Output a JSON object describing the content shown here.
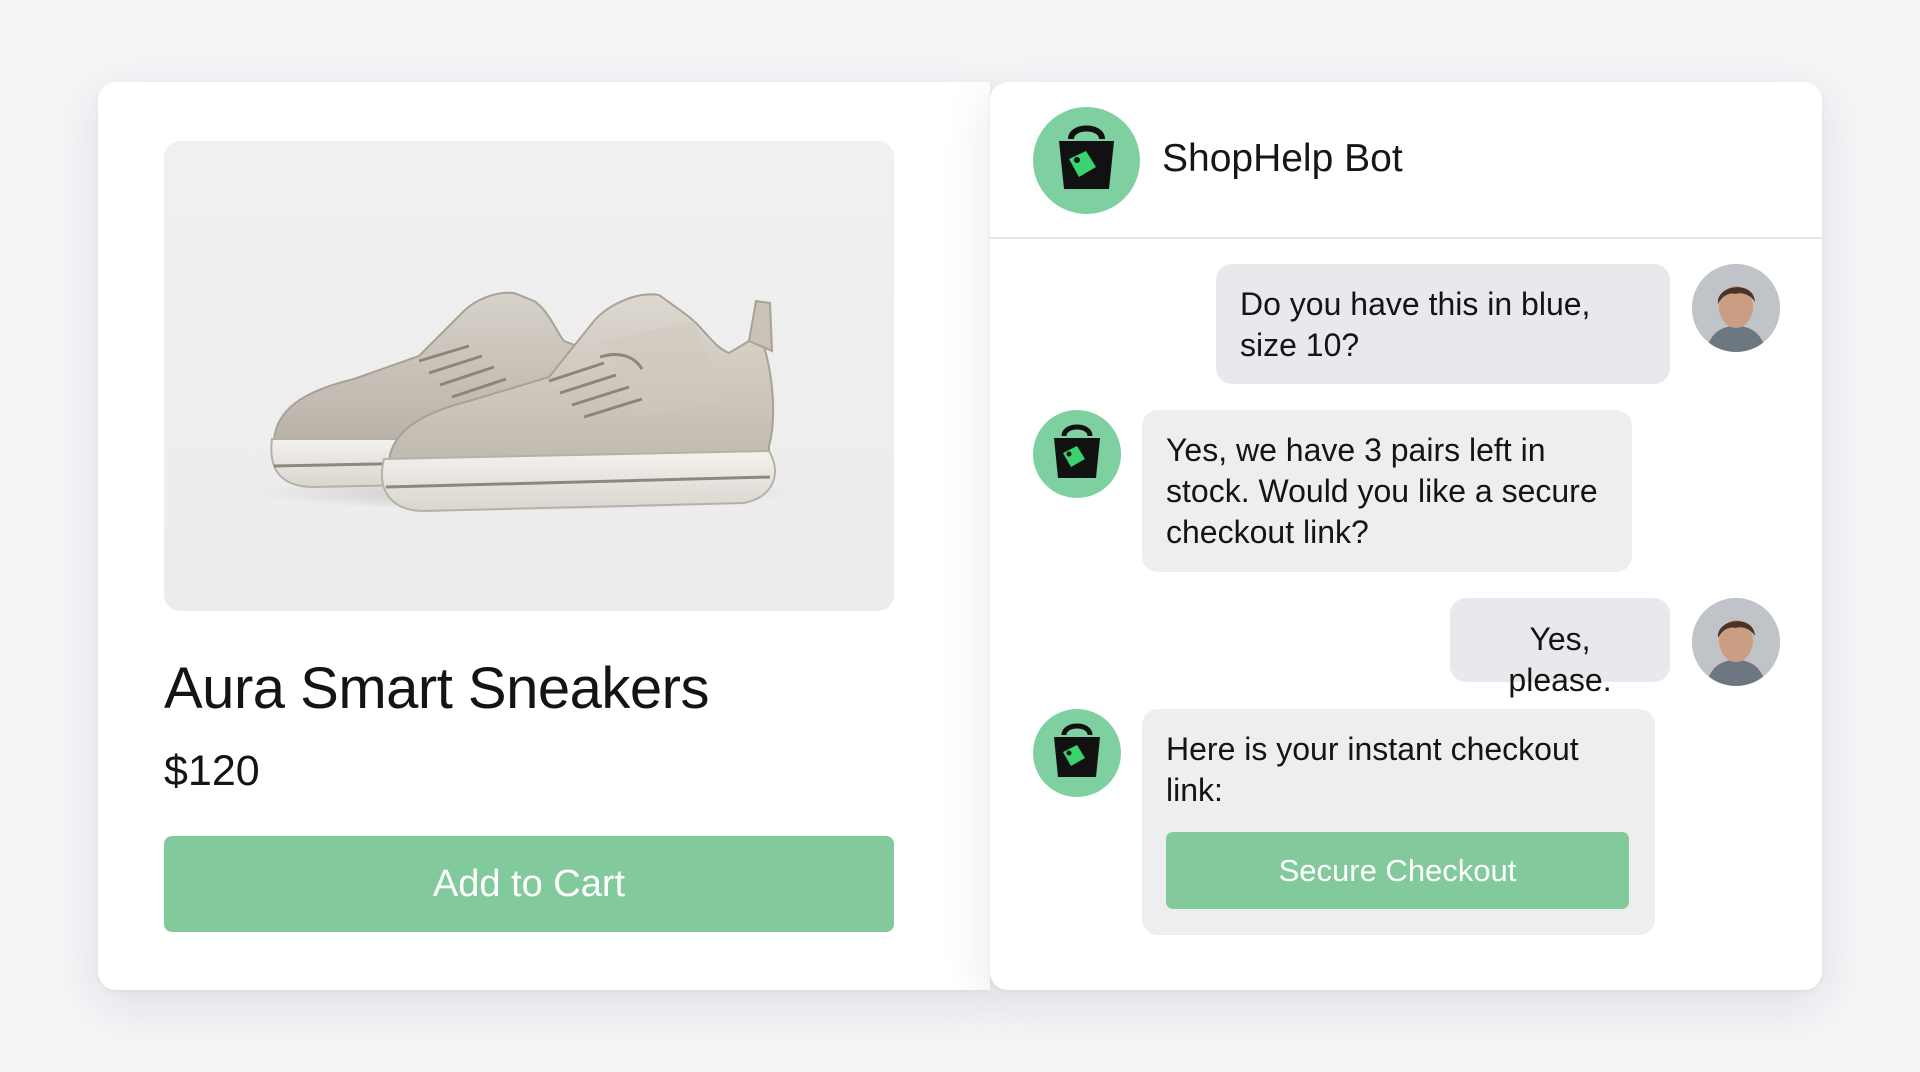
{
  "product": {
    "image_alt": "Aura Smart Sneakers product photo",
    "title": "Aura Smart Sneakers",
    "price": "$120",
    "add_to_cart_label": "Add to Cart"
  },
  "chat": {
    "title": "ShopHelp Bot",
    "bot_icon": "shopping-bag-tag-icon",
    "messages": [
      {
        "sender": "user",
        "text": "Do you have this in blue,\nsize 10?"
      },
      {
        "sender": "bot",
        "text": "Yes, we have 3 pairs left in\nstock. Would you like a secure\ncheckout link?"
      },
      {
        "sender": "user",
        "text": "Yes, please."
      },
      {
        "sender": "bot",
        "text": "Here is your instant checkout\nlink:",
        "button_label": "Secure Checkout"
      }
    ]
  },
  "colors": {
    "accent_green": "#82c99b",
    "avatar_green": "#7fd0a0",
    "bubble_gray": "#eceef0",
    "page_bg": "#f4f5f7"
  }
}
